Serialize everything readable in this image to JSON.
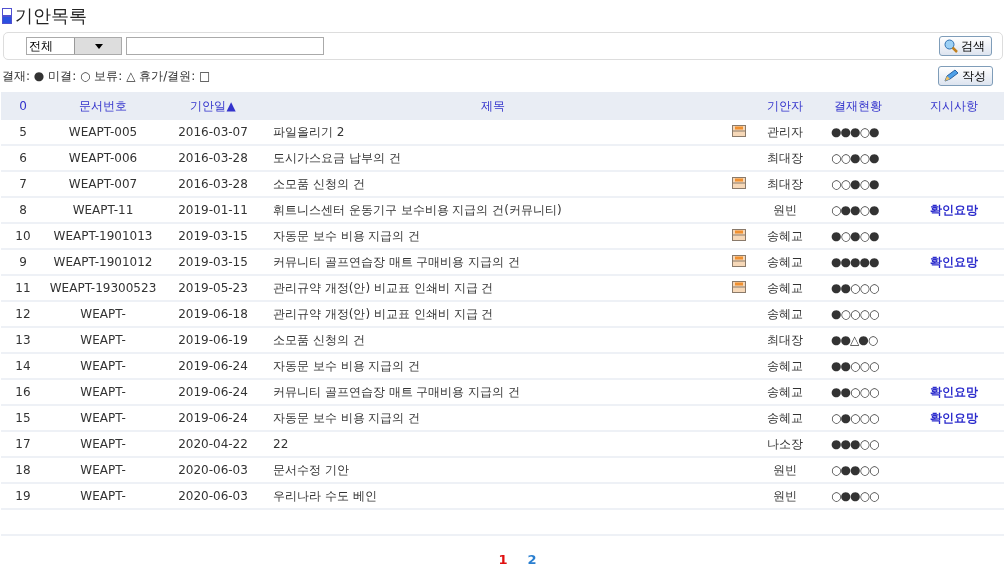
{
  "title": "기안목록",
  "search": {
    "filter": "전체",
    "button": "검색"
  },
  "legend": "결재: ● 미결: ○ 보류: △ 휴가/결원: □",
  "write_button": "작성",
  "table": {
    "columns": [
      "0",
      "문서번호",
      "기안일▲",
      "제목",
      "",
      "기안자",
      "결재현황",
      "지시사항"
    ],
    "rows": [
      {
        "no": "5",
        "doc": "WEAPT-005",
        "date": "2016-03-07",
        "subject": "파일올리기 2",
        "attachment": true,
        "drafter": "관리자",
        "status": "●●●○●"
      },
      {
        "no": "6",
        "doc": "WEAPT-006",
        "date": "2016-03-28",
        "subject": "도시가스요금 납부의 건",
        "attachment": false,
        "drafter": "최대장",
        "status": "○○●○●"
      },
      {
        "no": "7",
        "doc": "WEAPT-007",
        "date": "2016-03-28",
        "subject": "소모품 신청의 건",
        "attachment": true,
        "drafter": "최대장",
        "status": "○○●○●"
      },
      {
        "no": "8",
        "doc": "WEAPT-11",
        "date": "2019-01-11",
        "subject": "휘트니스센터 운동기구 보수비용 지급의 건(커뮤니티)",
        "attachment": false,
        "drafter": "원빈",
        "status": "○●●○●",
        "note": "확인요망"
      },
      {
        "no": "10",
        "doc": "WEAPT-1901013",
        "date": "2019-03-15",
        "subject": "자동문 보수 비용 지급의 건",
        "attachment": true,
        "drafter": "송혜교",
        "status": "●○●○●"
      },
      {
        "no": "9",
        "doc": "WEAPT-1901012",
        "date": "2019-03-15",
        "subject": "커뮤니티 골프연습장 매트 구매비용 지급의 건",
        "attachment": true,
        "drafter": "송혜교",
        "status": "●●●●●",
        "note": "확인요망"
      },
      {
        "no": "11",
        "doc": "WEAPT-19300523",
        "date": "2019-05-23",
        "subject": "관리규약 개정(안) 비교표 인쇄비 지급 건",
        "attachment": true,
        "drafter": "송혜교",
        "status": "●●○○○"
      },
      {
        "no": "12",
        "doc": "WEAPT-",
        "date": "2019-06-18",
        "subject": "관리규약 개정(안) 비교표 인쇄비 지급 건",
        "attachment": false,
        "drafter": "송혜교",
        "status": "●○○○○"
      },
      {
        "no": "13",
        "doc": "WEAPT-",
        "date": "2019-06-19",
        "subject": "소모품 신청의 건",
        "attachment": false,
        "drafter": "최대장",
        "status": "●●△●○"
      },
      {
        "no": "14",
        "doc": "WEAPT-",
        "date": "2019-06-24",
        "subject": "자동문 보수 비용 지급의 건",
        "attachment": false,
        "drafter": "송혜교",
        "status": "●●○○○"
      },
      {
        "no": "16",
        "doc": "WEAPT-",
        "date": "2019-06-24",
        "subject": "커뮤니티 골프연습장 매트 구매비용 지급의 건",
        "attachment": false,
        "drafter": "송혜교",
        "status": "●●○○○",
        "note": "확인요망"
      },
      {
        "no": "15",
        "doc": "WEAPT-",
        "date": "2019-06-24",
        "subject": "자동문 보수 비용 지급의 건",
        "attachment": false,
        "drafter": "송혜교",
        "status": "○●○○○",
        "note": "확인요망"
      },
      {
        "no": "17",
        "doc": "WEAPT-",
        "date": "2020-04-22",
        "subject": "22",
        "attachment": false,
        "drafter": "나소장",
        "status": "●●●○○"
      },
      {
        "no": "18",
        "doc": "WEAPT-",
        "date": "2020-06-03",
        "subject": "문서수정 기안",
        "attachment": false,
        "drafter": "원빈",
        "status": "○●●○○"
      },
      {
        "no": "19",
        "doc": "WEAPT-",
        "date": "2020-06-03",
        "subject": "우리나라 수도 베인",
        "attachment": false,
        "drafter": "원빈",
        "status": "○●●○○"
      }
    ]
  },
  "pagination": [
    {
      "label": "1",
      "selected": true
    },
    {
      "label": "2",
      "selected": false
    }
  ]
}
